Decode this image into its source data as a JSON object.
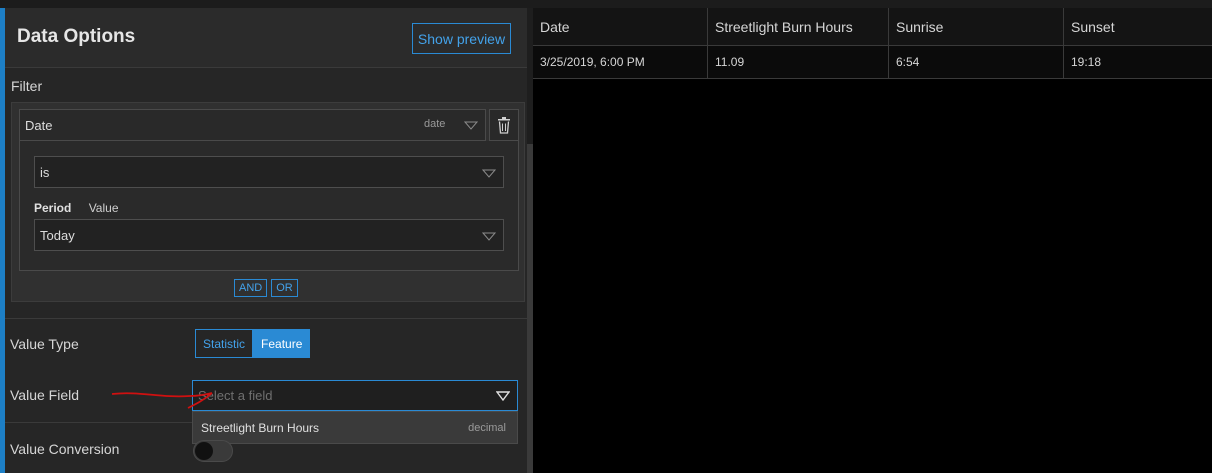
{
  "panel": {
    "title": "Data Options",
    "preview_label": "Show preview",
    "filter": {
      "label": "Filter",
      "field_name": "Date",
      "field_type": "date",
      "operator": "is",
      "period_label": "Period",
      "value_label": "Value",
      "period_value": "Today",
      "and_label": "AND",
      "or_label": "OR"
    },
    "value_type": {
      "label": "Value Type",
      "options": [
        "Statistic",
        "Feature"
      ],
      "selected": "Feature"
    },
    "value_field": {
      "label": "Value Field",
      "placeholder": "Select a field",
      "option_label": "Streetlight Burn Hours",
      "option_type": "decimal"
    },
    "value_conversion": {
      "label": "Value Conversion",
      "enabled": false
    }
  },
  "table": {
    "columns": [
      "Date",
      "Streetlight Burn Hours",
      "Sunrise",
      "Sunset"
    ],
    "rows": [
      [
        "3/25/2019, 6:00 PM",
        "11.09",
        "6:54",
        "19:18"
      ]
    ]
  },
  "colors": {
    "accent": "#2a8ad4",
    "panel_bg": "#262626",
    "table_bg": "#000000",
    "annotation": "#d01010"
  }
}
